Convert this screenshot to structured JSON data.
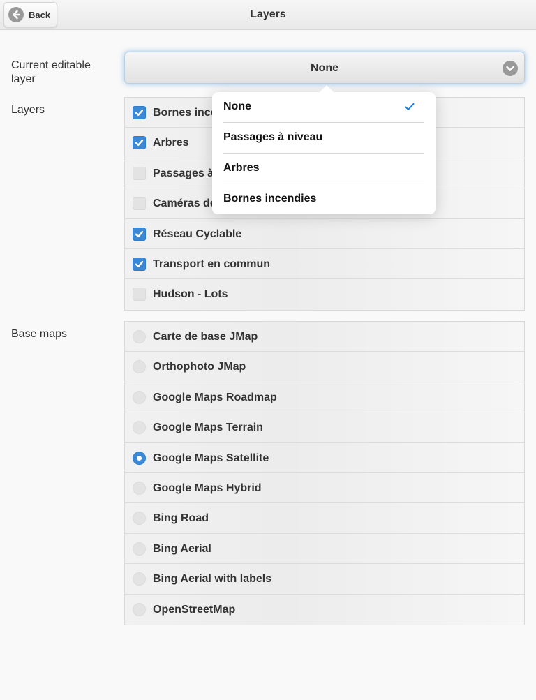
{
  "header": {
    "title": "Layers",
    "back_label": "Back"
  },
  "labels": {
    "current_editable_layer": "Current editable layer",
    "layers": "Layers",
    "base_maps": "Base maps"
  },
  "editable_select": {
    "value": "None",
    "options": [
      {
        "label": "None",
        "selected": true
      },
      {
        "label": "Passages à niveau",
        "selected": false
      },
      {
        "label": "Arbres",
        "selected": false
      },
      {
        "label": "Bornes incendies",
        "selected": false
      }
    ]
  },
  "layers": [
    {
      "label": "Bornes incendies",
      "checked": true
    },
    {
      "label": "Arbres",
      "checked": true
    },
    {
      "label": "Passages à niveau",
      "checked": false
    },
    {
      "label": "Caméras de surveillance",
      "checked": false
    },
    {
      "label": "Réseau Cyclable",
      "checked": true
    },
    {
      "label": "Transport en commun",
      "checked": true
    },
    {
      "label": "Hudson - Lots",
      "checked": false
    }
  ],
  "base_maps": [
    {
      "label": "Carte de base JMap",
      "selected": false
    },
    {
      "label": "Orthophoto JMap",
      "selected": false
    },
    {
      "label": "Google Maps Roadmap",
      "selected": false
    },
    {
      "label": "Google Maps Terrain",
      "selected": false
    },
    {
      "label": "Google Maps Satellite",
      "selected": true
    },
    {
      "label": "Google Maps Hybrid",
      "selected": false
    },
    {
      "label": "Bing Road",
      "selected": false
    },
    {
      "label": "Bing Aerial",
      "selected": false
    },
    {
      "label": "Bing Aerial with labels",
      "selected": false
    },
    {
      "label": "OpenStreetMap",
      "selected": false
    }
  ],
  "colors": {
    "accent": "#3b89d6",
    "check": "#1a7ee0"
  },
  "icons": {
    "back": "back-arrow-icon",
    "select_arrow": "chevron-down-icon",
    "checkmark": "checkmark-icon"
  }
}
